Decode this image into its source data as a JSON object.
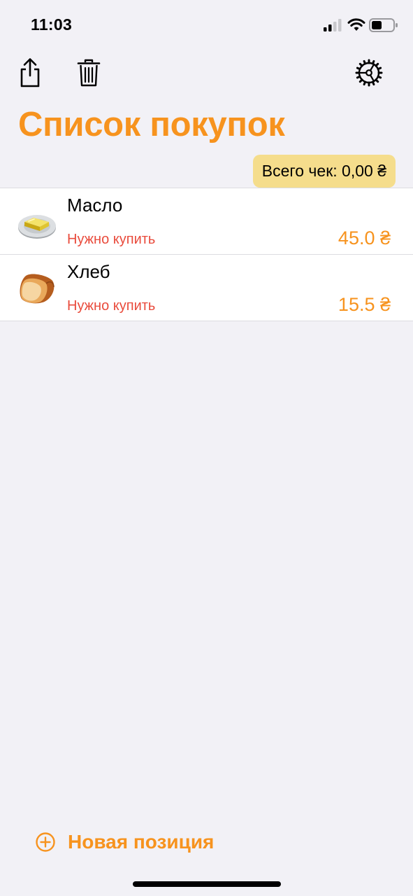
{
  "status_bar": {
    "time": "11:03"
  },
  "toolbar": {
    "share_icon": "share-icon",
    "trash_icon": "trash-icon",
    "settings_icon": "gear-icon"
  },
  "header": {
    "title": "Список покупок"
  },
  "total": {
    "label": "Всего чек: 0,00 ₴"
  },
  "items": [
    {
      "name": "Масло",
      "status": "Нужно купить",
      "price": "45.0 ₴",
      "icon": "butter-icon"
    },
    {
      "name": "Хлеб",
      "status": "Нужно купить",
      "price": "15.5 ₴",
      "icon": "bread-icon"
    }
  ],
  "footer": {
    "new_item_label": "Новая позиция",
    "icon": "plus-circle-icon"
  },
  "colors": {
    "accent": "#f7931e",
    "status": "#e94b3c",
    "badge": "#f5dd8c",
    "background": "#f2f1f6"
  }
}
